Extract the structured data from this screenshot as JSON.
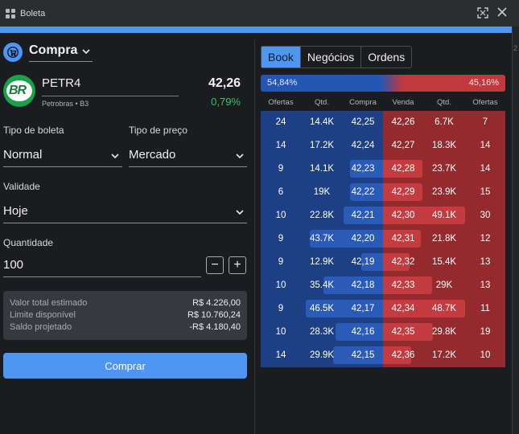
{
  "window": {
    "title": "Boleta"
  },
  "side": {
    "label": "Compra"
  },
  "asset": {
    "ticker": "PETR4",
    "company": "Petrobras • B3",
    "price": "42,26",
    "change": "0,79%",
    "logo_text": "BR"
  },
  "form": {
    "order_type_label": "Tipo de boleta",
    "order_type_value": "Normal",
    "price_type_label": "Tipo de preço",
    "price_type_value": "Mercado",
    "validity_label": "Validade",
    "validity_value": "Hoje",
    "quantity_label": "Quantidade",
    "quantity_value": "100",
    "minus": "−",
    "plus": "+"
  },
  "summary": {
    "rows": [
      {
        "label": "Valor total estimado",
        "value": "R$ 4.226,00"
      },
      {
        "label": "Limite disponível",
        "value": "R$ 10.760,24"
      },
      {
        "label": "Saldo projetado",
        "value": "-R$ 4.180,40"
      }
    ]
  },
  "buy_button": "Comprar",
  "tabs": [
    {
      "label": "Book",
      "active": true
    },
    {
      "label": "Negócios",
      "active": false
    },
    {
      "label": "Ordens",
      "active": false
    }
  ],
  "ratio": {
    "buy_pct": "54,84%",
    "sell_pct": "45,16%",
    "buy_fraction": 0.5484
  },
  "book_headers": {
    "bid_offers": "Ofertas",
    "bid_qty": "Qtd.",
    "bid_price": "Compra",
    "ask_price": "Venda",
    "ask_qty": "Qtd.",
    "ask_offers": "Ofertas"
  },
  "book": [
    {
      "bid_offers": "24",
      "bid_qty": "14.4K",
      "bid_price": "42,25",
      "ask_price": "42,26",
      "ask_qty": "6.7K",
      "ask_offers": "7",
      "bid_depth": 0.0,
      "ask_depth": 0.0
    },
    {
      "bid_offers": "14",
      "bid_qty": "17.2K",
      "bid_price": "42,24",
      "ask_price": "42,27",
      "ask_qty": "18.3K",
      "ask_offers": "14",
      "bid_depth": 0.0,
      "ask_depth": 0.0
    },
    {
      "bid_offers": "9",
      "bid_qty": "14.1K",
      "bid_price": "42,23",
      "ask_price": "42,28",
      "ask_qty": "23.7K",
      "ask_offers": "14",
      "bid_depth": 0.27,
      "ask_depth": 0.32
    },
    {
      "bid_offers": "6",
      "bid_qty": "19K",
      "bid_price": "42,22",
      "ask_price": "42,29",
      "ask_qty": "23.9K",
      "ask_offers": "15",
      "bid_depth": 0.27,
      "ask_depth": 0.32
    },
    {
      "bid_offers": "10",
      "bid_qty": "22.8K",
      "bid_price": "42,21",
      "ask_price": "42,30",
      "ask_qty": "49.1K",
      "ask_offers": "30",
      "bid_depth": 0.32,
      "ask_depth": 0.67
    },
    {
      "bid_offers": "9",
      "bid_qty": "43.7K",
      "bid_price": "42,20",
      "ask_price": "42,31",
      "ask_qty": "21.8K",
      "ask_offers": "12",
      "bid_depth": 0.6,
      "ask_depth": 0.31
    },
    {
      "bid_offers": "9",
      "bid_qty": "12.9K",
      "bid_price": "42,19",
      "ask_price": "42,32",
      "ask_qty": "15.4K",
      "ask_offers": "13",
      "bid_depth": 0.18,
      "ask_depth": 0.22
    },
    {
      "bid_offers": "10",
      "bid_qty": "35.4K",
      "bid_price": "42,18",
      "ask_price": "42,33",
      "ask_qty": "29K",
      "ask_offers": "13",
      "bid_depth": 0.49,
      "ask_depth": 0.4
    },
    {
      "bid_offers": "9",
      "bid_qty": "46.5K",
      "bid_price": "42,17",
      "ask_price": "42,34",
      "ask_qty": "48.7K",
      "ask_offers": "11",
      "bid_depth": 0.63,
      "ask_depth": 0.67
    },
    {
      "bid_offers": "10",
      "bid_qty": "28.3K",
      "bid_price": "42,16",
      "ask_price": "42,35",
      "ask_qty": "29.8K",
      "ask_offers": "19",
      "bid_depth": 0.39,
      "ask_depth": 0.41
    },
    {
      "bid_offers": "14",
      "bid_qty": "29.9K",
      "bid_price": "42,15",
      "ask_price": "42,36",
      "ask_qty": "17.2K",
      "ask_offers": "10",
      "bid_depth": 0.41,
      "ask_depth": 0.23
    }
  ],
  "edge": {
    "text": "2"
  },
  "colors": {
    "accent": "#4f96f2",
    "bid": "#1c3f86",
    "ask": "#952a2e",
    "positive": "#33c165",
    "panel": "#1b1c1f"
  }
}
